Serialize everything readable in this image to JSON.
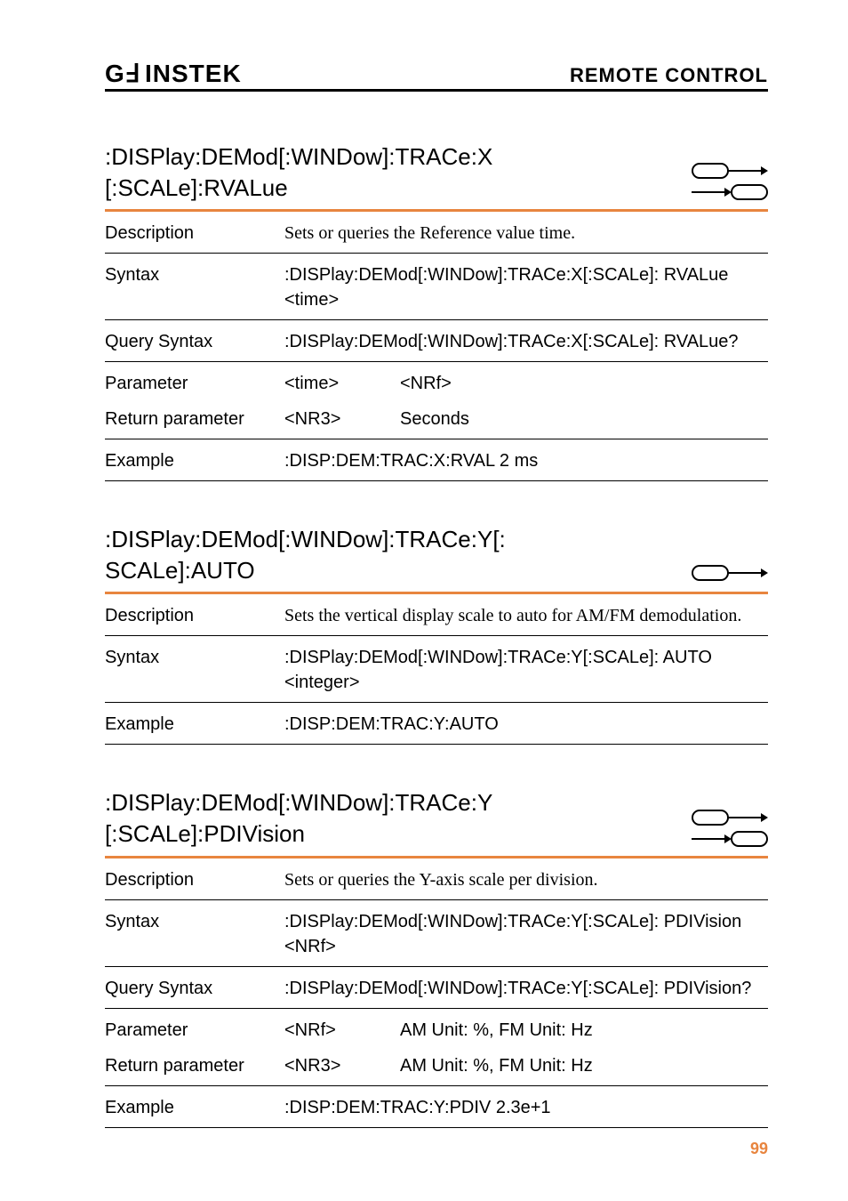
{
  "header": {
    "brand_gw": "G",
    "brand_u": "⫫",
    "brand_instek": "INSTEK",
    "section": "REMOTE CONTROL"
  },
  "sections": [
    {
      "title_line1": ":DISPlay:DEMod[:WINDow]:TRACe:X",
      "title_line2": "[:SCALe]:RVALue",
      "icons": "both",
      "rows": [
        {
          "label": "Description",
          "type": "serif",
          "value": "Sets or queries the Reference value time."
        },
        {
          "label": "Syntax",
          "type": "plain",
          "value": ":DISPlay:DEMod[:WINDow]:TRACe:X[:SCALe]: RVALue <time>"
        },
        {
          "label": "Query Syntax",
          "type": "plain",
          "value": ":DISPlay:DEMod[:WINDow]:TRACe:X[:SCALe]: RVALue?"
        },
        {
          "label": "Parameter",
          "type": "twocol",
          "c1": "<time>",
          "c2": "<NRf>",
          "noborder": true
        },
        {
          "label": "Return parameter",
          "type": "twocol",
          "c1": "<NR3>",
          "c2": "Seconds"
        },
        {
          "label": "Example",
          "type": "plain",
          "value": ":DISP:DEM:TRAC:X:RVAL 2 ms"
        }
      ]
    },
    {
      "title_line1": ":DISPlay:DEMod[:WINDow]:TRACe:Y[:",
      "title_line2": "SCALe]:AUTO",
      "icons": "set",
      "rows": [
        {
          "label": "Description",
          "type": "serif",
          "value": "Sets the vertical display scale to auto for AM/FM demodulation."
        },
        {
          "label": "Syntax",
          "type": "plain",
          "value": ":DISPlay:DEMod[:WINDow]:TRACe:Y[:SCALe]: AUTO <integer>"
        },
        {
          "label": "Example",
          "type": "plain",
          "value": ":DISP:DEM:TRAC:Y:AUTO"
        }
      ]
    },
    {
      "title_line1": ":DISPlay:DEMod[:WINDow]:TRACe:Y",
      "title_line2": "[:SCALe]:PDIVision",
      "icons": "both",
      "rows": [
        {
          "label": "Description",
          "type": "serif",
          "value": "Sets or queries the Y-axis scale per division."
        },
        {
          "label": "Syntax",
          "type": "plain",
          "value": ":DISPlay:DEMod[:WINDow]:TRACe:Y[:SCALe]: PDIVision <NRf>"
        },
        {
          "label": "Query Syntax",
          "type": "plain",
          "value": ":DISPlay:DEMod[:WINDow]:TRACe:Y[:SCALe]: PDIVision?"
        },
        {
          "label": "Parameter",
          "type": "twocol",
          "c1": "<NRf>",
          "c2": "AM Unit: %, FM Unit: Hz",
          "noborder": true
        },
        {
          "label": "Return parameter",
          "type": "twocol",
          "c1": "<NR3>",
          "c2": "AM Unit: %, FM Unit: Hz"
        },
        {
          "label": "Example",
          "type": "plain",
          "value": ":DISP:DEM:TRAC:Y:PDIV 2.3e+1"
        }
      ]
    }
  ],
  "page_number": "99"
}
